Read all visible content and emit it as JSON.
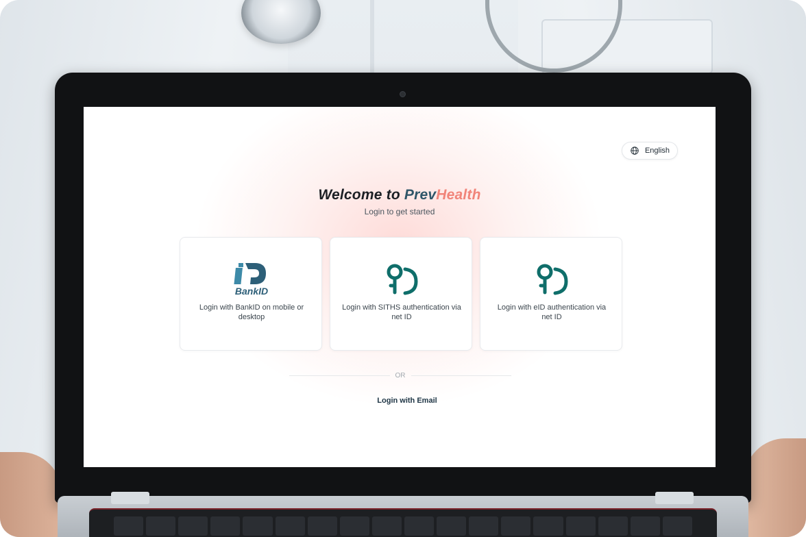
{
  "header": {
    "language_label": "English"
  },
  "welcome": {
    "prefix": "Welcome to",
    "brand_part1": "Prev",
    "brand_part2": "Health",
    "subtitle": "Login to get started"
  },
  "login_options": [
    {
      "icon": "bankid-logo",
      "logo_text": "BankID",
      "label": "Login with BankID on mobile or desktop"
    },
    {
      "icon": "net-id-icon",
      "label": "Login with SITHS authentication via net ID"
    },
    {
      "icon": "net-id-icon",
      "label": "Login with eID authentication via net ID"
    }
  ],
  "divider": {
    "text": "OR"
  },
  "email_login": {
    "label": "Login with Email"
  },
  "colors": {
    "brand_dark": "#2f5669",
    "brand_coral": "#f18479",
    "netid_teal": "#0f6e6a",
    "bankid_blue": "#2d5f78"
  }
}
